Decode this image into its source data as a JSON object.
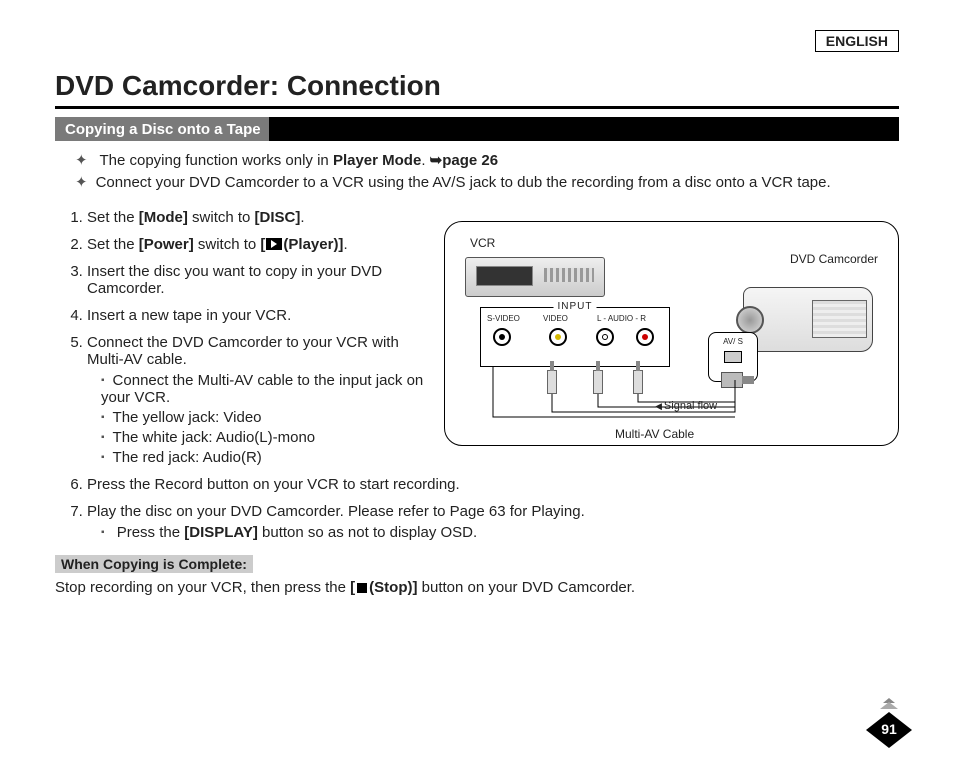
{
  "language": "ENGLISH",
  "title": "DVD Camcorder: Connection",
  "section": "Copying a Disc onto a Tape",
  "intro": [
    {
      "pre": "The copying function works only in ",
      "bold": "Player Mode",
      "post": ". ",
      "ref": "➥page 26"
    },
    {
      "text": "Connect your DVD Camcorder to a VCR using the AV/S jack to dub the recording from a disc onto a VCR tape."
    }
  ],
  "steps": {
    "s1": {
      "a": "Set the ",
      "b": "[Mode]",
      "c": " switch to ",
      "d": "[DISC]",
      "e": "."
    },
    "s2": {
      "a": "Set the ",
      "b": "[Power]",
      "c": " switch to ",
      "d": "(Player)]",
      "pre_icon": "[",
      "e": "."
    },
    "s3": "Insert the disc you want to copy in your DVD Camcorder.",
    "s4": "Insert a new tape in your VCR.",
    "s5": "Connect the DVD Camcorder to your VCR with Multi-AV cable.",
    "s5sub": [
      "Connect the Multi-AV cable to the input jack on your VCR.",
      "The yellow jack: Video",
      "The white jack: Audio(L)-mono",
      "The red jack: Audio(R)"
    ],
    "s6": "Press the Record button on your VCR to start recording.",
    "s7": "Play the disc on your DVD Camcorder. Please refer to Page 63 for Playing.",
    "s7sub_a": "Press the ",
    "s7sub_b": "[DISPLAY]",
    "s7sub_c": " button so as not to display OSD."
  },
  "complete_label": "When Copying is Complete:",
  "complete_text_a": "Stop recording on your VCR, then press the ",
  "complete_text_b": "(Stop)]",
  "complete_text_pre": "[",
  "complete_text_c": " button on your DVD Camcorder.",
  "diagram": {
    "vcr": "VCR",
    "dvd": "DVD Camcorder",
    "input": "INPUT",
    "svideo": "S-VIDEO",
    "video": "VIDEO",
    "audio": "L - AUDIO - R",
    "av": "AV/ S",
    "signal": "Signal flow",
    "cable": "Multi-AV Cable"
  },
  "page_number": "91"
}
